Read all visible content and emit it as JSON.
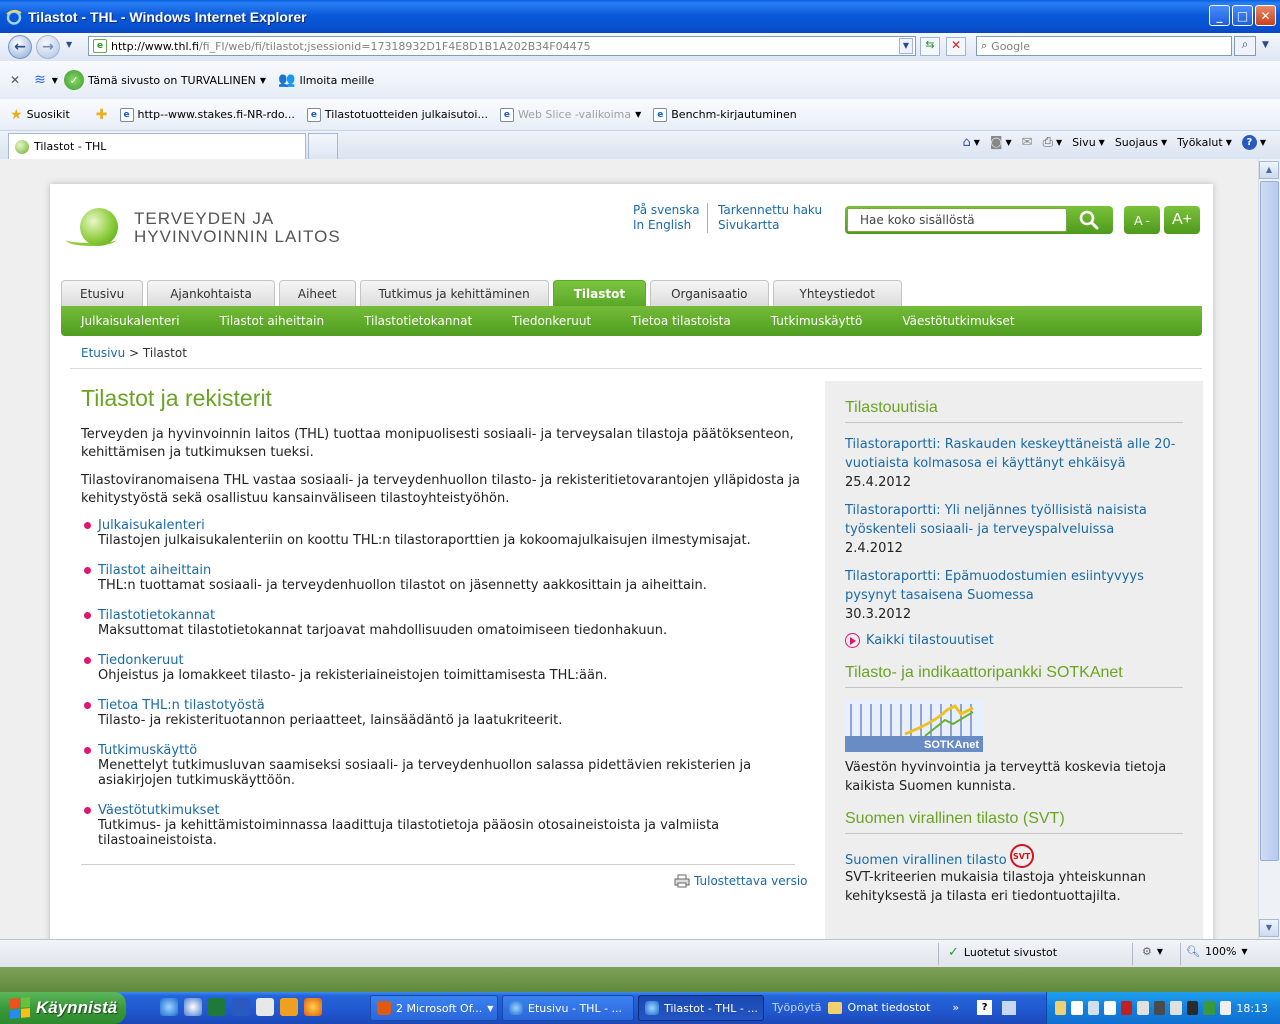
{
  "window": {
    "title": "Tilastot - THL - Windows Internet Explorer"
  },
  "nav": {
    "url_host": "http://www.thl.fi",
    "url_rest": "/fi_FI/web/fi/tilastot;jsessionid=17318932D1F4E8D1B1A202B34F04475",
    "search_placeholder": "Google"
  },
  "infobar": {
    "safe_label": "Tämä sivusto on TURVALLINEN",
    "report_label": "Ilmoita meille"
  },
  "favorites": {
    "label": "Suosikit",
    "items": [
      {
        "label": "http--www.stakes.fi-NR-rdo..."
      },
      {
        "label": "Tilastotuotteiden julkaisutoi..."
      },
      {
        "label": "Web Slice -valikoima"
      },
      {
        "label": "Benchm-kirjautuminen"
      }
    ]
  },
  "tabs": {
    "active_label": "Tilastot - THL"
  },
  "commands": {
    "page": "Sivu",
    "safety": "Suojaus",
    "tools": "Työkalut"
  },
  "site": {
    "logo_line1": "TERVEYDEN JA",
    "logo_line2": "HYVINVOINNIN LAITOS",
    "lang_sv": "På svenska",
    "lang_en": "In English",
    "advanced_search": "Tarkennettu haku",
    "sitemap": "Sivukartta",
    "search_placeholder": "Hae koko sisällöstä",
    "font_smaller": "A -",
    "font_larger": "A+",
    "main_tabs": [
      {
        "label": "Etusivu"
      },
      {
        "label": "Ajankohtaista"
      },
      {
        "label": "Aiheet"
      },
      {
        "label": "Tutkimus ja kehittäminen"
      },
      {
        "label": "Tilastot"
      },
      {
        "label": "Organisaatio"
      },
      {
        "label": "Yhteystiedot"
      }
    ],
    "sub_nav": [
      {
        "label": "Julkaisukalenteri"
      },
      {
        "label": "Tilastot aiheittain"
      },
      {
        "label": "Tilastotietokannat"
      },
      {
        "label": "Tiedonkeruut"
      },
      {
        "label": "Tietoa tilastoista"
      },
      {
        "label": "Tutkimuskäyttö"
      },
      {
        "label": "Väestötutkimukset"
      }
    ],
    "breadcrumb_home": "Etusivu",
    "breadcrumb_sep": ">",
    "breadcrumb_current": "Tilastot"
  },
  "main": {
    "title": "Tilastot ja rekisterit",
    "para1": "Terveyden ja hyvinvoinnin laitos (THL) tuottaa monipuolisesti sosiaali- ja terveysalan tilastoja päätöksenteon, kehittämisen ja tutkimuksen tueksi.",
    "para2": "Tilastoviranomaisena THL vastaa sosiaali- ja terveydenhuollon tilasto- ja rekisteritietovarantojen ylläpidosta ja kehitystyöstä sekä osallistuu kansainväliseen tilastoyhteistyöhön.",
    "links": [
      {
        "title": "Julkaisukalenteri",
        "desc": "Tilastojen julkaisukalenteriin on koottu THL:n tilastoraporttien ja kokoomajulkaisujen ilmestymisajat."
      },
      {
        "title": "Tilastot aiheittain",
        "desc": "THL:n tuottamat sosiaali- ja terveydenhuollon tilastot on jäsennetty aakkosittain ja aiheittain."
      },
      {
        "title": "Tilastotietokannat",
        "desc": "Maksuttomat tilastotietokannat tarjoavat mahdollisuuden omatoimiseen tiedonhakuun."
      },
      {
        "title": "Tiedonkeruut",
        "desc": "Ohjeistus ja lomakkeet tilasto- ja rekisteriaineistojen toimittamisesta THL:ään."
      },
      {
        "title": "Tietoa THL:n tilastotyöstä",
        "desc": "Tilasto- ja rekisterituotannon periaatteet, lainsäädäntö ja laatukriteerit."
      },
      {
        "title": "Tutkimuskäyttö",
        "desc": "Menettelyt tutkimusluvan saamiseksi sosiaali- ja terveydenhuollon salassa pidettävien rekisterien ja asiakirjojen tutkimuskäyttöön."
      },
      {
        "title": "Väestötutkimukset",
        "desc": "Tutkimus- ja kehittämistoiminnassa laadittuja tilastotietoja pääosin otosaineistoista ja valmiista tilastoaineistoista."
      }
    ],
    "print_label": "Tulostettava versio"
  },
  "sidebar": {
    "news_title": "Tilastouutisia",
    "news": [
      {
        "title": "Tilastoraportti: Raskauden keskeyttäneistä alle 20-vuotiaista kolmasosa ei käyttänyt ehkäisyä",
        "date": "25.4.2012"
      },
      {
        "title": "Tilastoraportti: Yli neljännes työllisistä naisista työskenteli sosiaali- ja terveyspalveluissa",
        "date": "2.4.2012"
      },
      {
        "title": "Tilastoraportti: Epämuodostumien esiintyvyys pysynyt tasaisena Suomessa",
        "date": "30.3.2012"
      }
    ],
    "all_news": "Kaikki tilastouutiset",
    "sotka_title": "Tilasto- ja indikaattoripankki SOTKAnet",
    "sotka_img_label": "SOTKAnet",
    "sotka_desc": "Väestön hyvinvointia ja terveyttä koskevia tietoja kaikista Suomen kunnista.",
    "svt_title": "Suomen virallinen tilasto (SVT)",
    "svt_link": "Suomen virallinen tilasto",
    "svt_badge": "SVT",
    "svt_desc": "SVT-kriteerien mukaisia tilastoja yhteiskunnan kehityksestä ja tilasta eri tiedontuottajilta."
  },
  "status": {
    "zone": "Luotetut sivustot",
    "zoom": "100%"
  },
  "taskbar": {
    "start": "Käynnistä",
    "buttons": [
      {
        "label": "2 Microsoft Of..."
      },
      {
        "label": "Etusivu - THL - ..."
      },
      {
        "label": "Tilastot - THL - ..."
      }
    ],
    "desktop": "Työpöytä",
    "my_files": "Omat tiedostot",
    "clock": "18:13"
  }
}
